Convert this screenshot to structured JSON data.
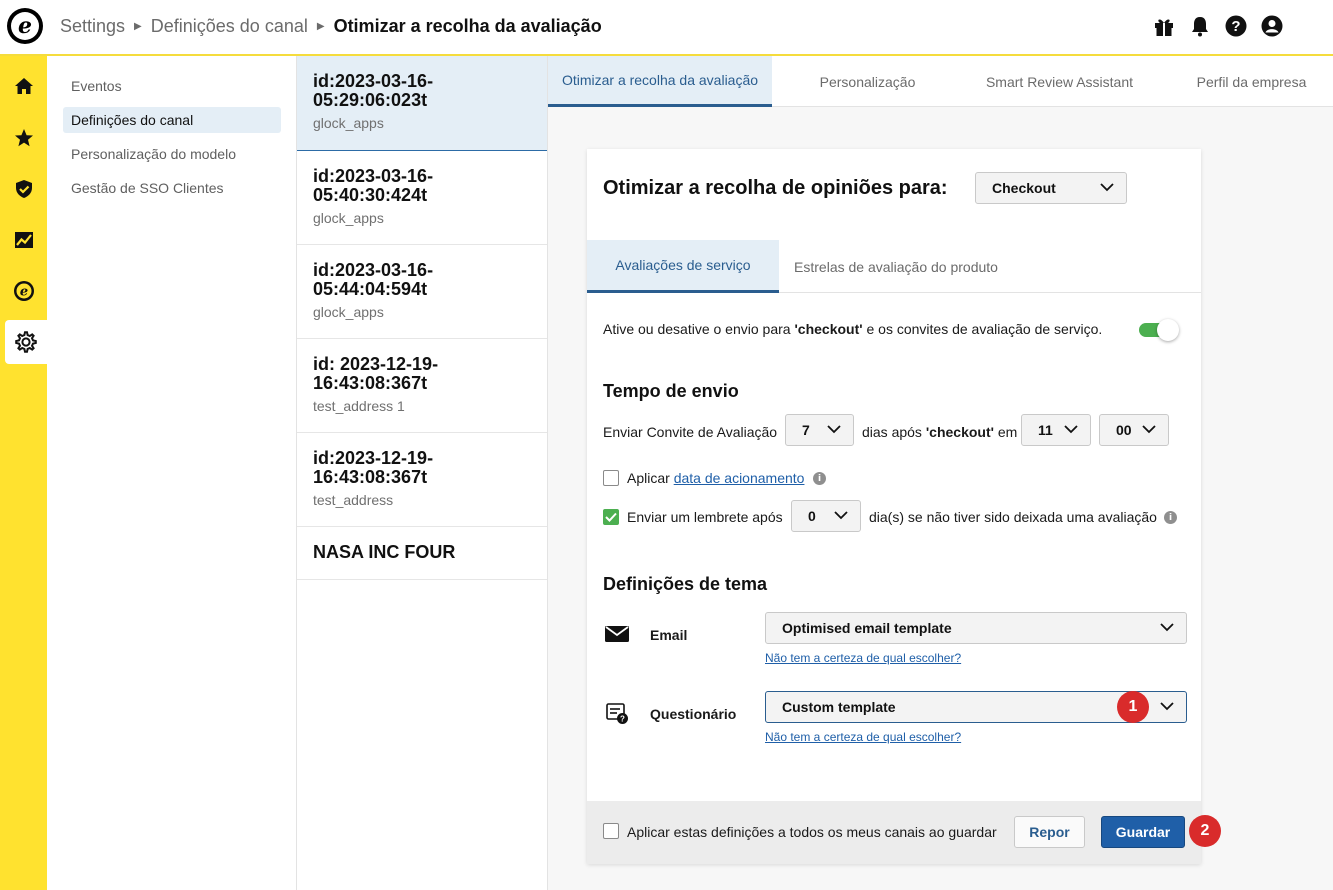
{
  "header": {
    "breadcrumbs": [
      "Settings",
      "Definições do canal"
    ],
    "current": "Otimizar a recolha da avaliação",
    "logo_letter": "e"
  },
  "rail": {
    "icons": [
      "home-icon",
      "star-icon",
      "shield-check-icon",
      "analytics-icon",
      "trustpilot-e-icon",
      "gear-icon"
    ],
    "accent": "#ffe22f"
  },
  "subnav": {
    "items": [
      "Eventos",
      "Definições do canal",
      "Personalização do modelo",
      "Gestão de SSO Clientes"
    ]
  },
  "channels": [
    {
      "title": "id:2023-03-16-05:29:06:023t",
      "sub": "glock_apps"
    },
    {
      "title": "id:2023-03-16-05:40:30:424t",
      "sub": "glock_apps"
    },
    {
      "title": "id:2023-03-16-05:44:04:594t",
      "sub": "glock_apps"
    },
    {
      "title": "id: 2023-12-19-16:43:08:367t",
      "sub": "test_address 1"
    },
    {
      "title": "id:2023-12-19-16:43:08:367t",
      "sub": "test_address"
    },
    {
      "title": "NASA INC FOUR",
      "sub": ""
    }
  ],
  "tabs": [
    "Otimizar a recolha da avaliação",
    "Personalização",
    "Smart Review Assistant",
    "Perfil da empresa"
  ],
  "card": {
    "title": "Otimizar a recolha de opiniões para:",
    "trigger_select": "Checkout",
    "inner_tabs": [
      "Avaliações de serviço",
      "Estrelas de avaliação do produto"
    ],
    "toggle_text_1": "Ative ou desative o envio para ",
    "toggle_text_bold": "'checkout'",
    "toggle_text_2": " e os convites de avaliação de serviço.",
    "toggle_on": true,
    "timing_title": "Tempo de envio",
    "send_label": "Enviar Convite de Avaliação",
    "days_value": "7",
    "days_after": "dias após ",
    "days_after_bold": "'checkout'",
    "days_after_2": " em",
    "hour_value": "11",
    "minute_value": "00",
    "apply_label": "Aplicar ",
    "apply_link": "data de acionamento",
    "apply_checked": false,
    "reminder_label": "Enviar um lembrete após",
    "reminder_value": "0",
    "reminder_after": "dia(s) se não tiver sido deixada uma avaliação",
    "reminder_checked": true,
    "theme_title": "Definições de tema",
    "email_label": "Email",
    "email_template": "Optimised email template",
    "help_link": "Não tem a certeza de qual escolher?",
    "questionnaire_label": "Questionário",
    "questionnaire_template": "Custom template",
    "apply_all_label": "Aplicar estas definições a todos os meus canais ao guardar",
    "reset_label": "Repor",
    "save_label": "Guardar"
  },
  "badges": [
    "1",
    "2"
  ],
  "colors": {
    "primary": "#1f5fa8",
    "active_bg": "#e4eef6",
    "badge": "#d92b2b",
    "toggle": "#4caf50"
  }
}
